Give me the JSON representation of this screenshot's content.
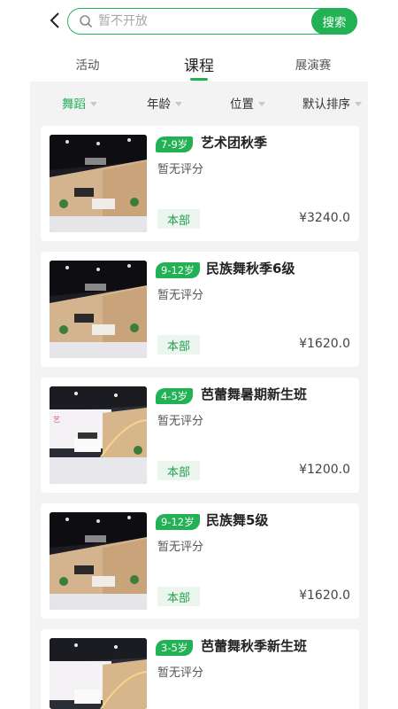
{
  "header": {
    "search_placeholder": "暂不开放",
    "search_button": "搜索"
  },
  "tabs": [
    {
      "label": "活动"
    },
    {
      "label": "课程"
    },
    {
      "label": "展演赛"
    }
  ],
  "filters": [
    {
      "label": "舞蹈"
    },
    {
      "label": "年龄"
    },
    {
      "label": "位置"
    },
    {
      "label": "默认排序"
    }
  ],
  "courses": [
    {
      "age": "7-9岁",
      "title": "艺术团秋季",
      "rating": "暂无评分",
      "campus": "本部",
      "price": "¥3240.0"
    },
    {
      "age": "9-12岁",
      "title": "民族舞秋季6级",
      "rating": "暂无评分",
      "campus": "本部",
      "price": "¥1620.0"
    },
    {
      "age": "4-5岁",
      "title": "芭蕾舞暑期新生班",
      "rating": "暂无评分",
      "campus": "本部",
      "price": "¥1200.0"
    },
    {
      "age": "9-12岁",
      "title": "民族舞5级",
      "rating": "暂无评分",
      "campus": "本部",
      "price": "¥1620.0"
    },
    {
      "age": "3-5岁",
      "title": "芭蕾舞秋季新生班",
      "rating": "暂无评分",
      "campus": "",
      "price": ""
    }
  ],
  "colors": {
    "accent": "#22b155"
  }
}
